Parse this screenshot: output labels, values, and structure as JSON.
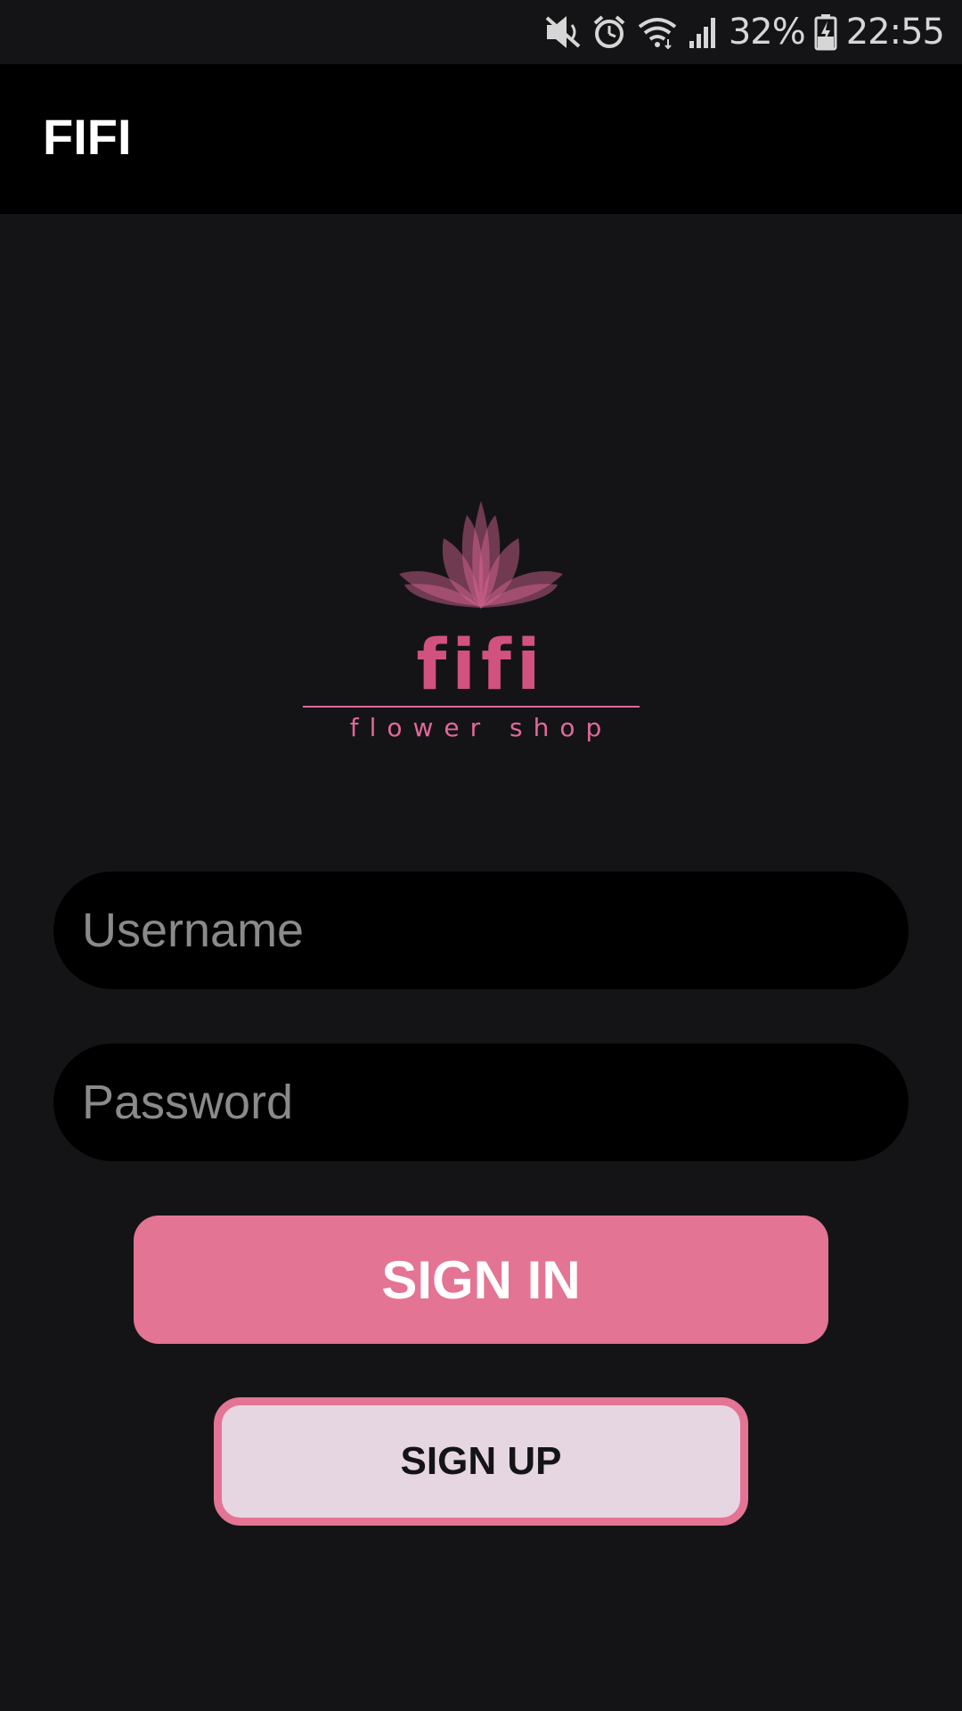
{
  "status_bar": {
    "battery": "32%",
    "time": "22:55",
    "icons": [
      "mute-icon",
      "alarm-icon",
      "wifi-icon",
      "signal-icon",
      "battery-charging-icon"
    ]
  },
  "app_bar": {
    "title": "FIFI"
  },
  "logo": {
    "name": "fifi",
    "tagline": "flower shop",
    "icon": "lotus-icon"
  },
  "form": {
    "username_placeholder": "Username",
    "username_value": "",
    "password_placeholder": "Password",
    "password_value": ""
  },
  "buttons": {
    "signin_label": "SIGN IN",
    "signup_label": "SIGN UP"
  },
  "colors": {
    "accent": "#e37494",
    "background": "#141416",
    "app_bar": "#000000",
    "signup_fill": "#e6d6e2"
  }
}
